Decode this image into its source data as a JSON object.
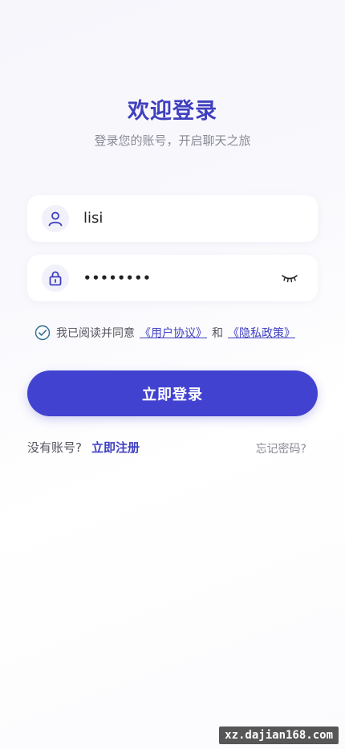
{
  "header": {
    "title": "欢迎登录",
    "subtitle": "登录您的账号，开启聊天之旅"
  },
  "form": {
    "username": {
      "value": "lisi",
      "icon": "user-icon"
    },
    "password": {
      "value": "••••••••",
      "icon": "lock-icon",
      "toggle_icon": "eye-closed-icon"
    },
    "agreement": {
      "checked": true,
      "prefix": "我已阅读并同意",
      "user_agreement": "《用户协议》",
      "joiner": "和",
      "privacy_policy": "《隐私政策》"
    },
    "login_label": "立即登录"
  },
  "footer": {
    "no_account": "没有账号?",
    "register_label": "立即注册",
    "forgot_label": "忘记密码?"
  },
  "watermark": "xz.dajian168.com",
  "colors": {
    "accent": "#4242d1",
    "title": "#3f3fbf"
  }
}
